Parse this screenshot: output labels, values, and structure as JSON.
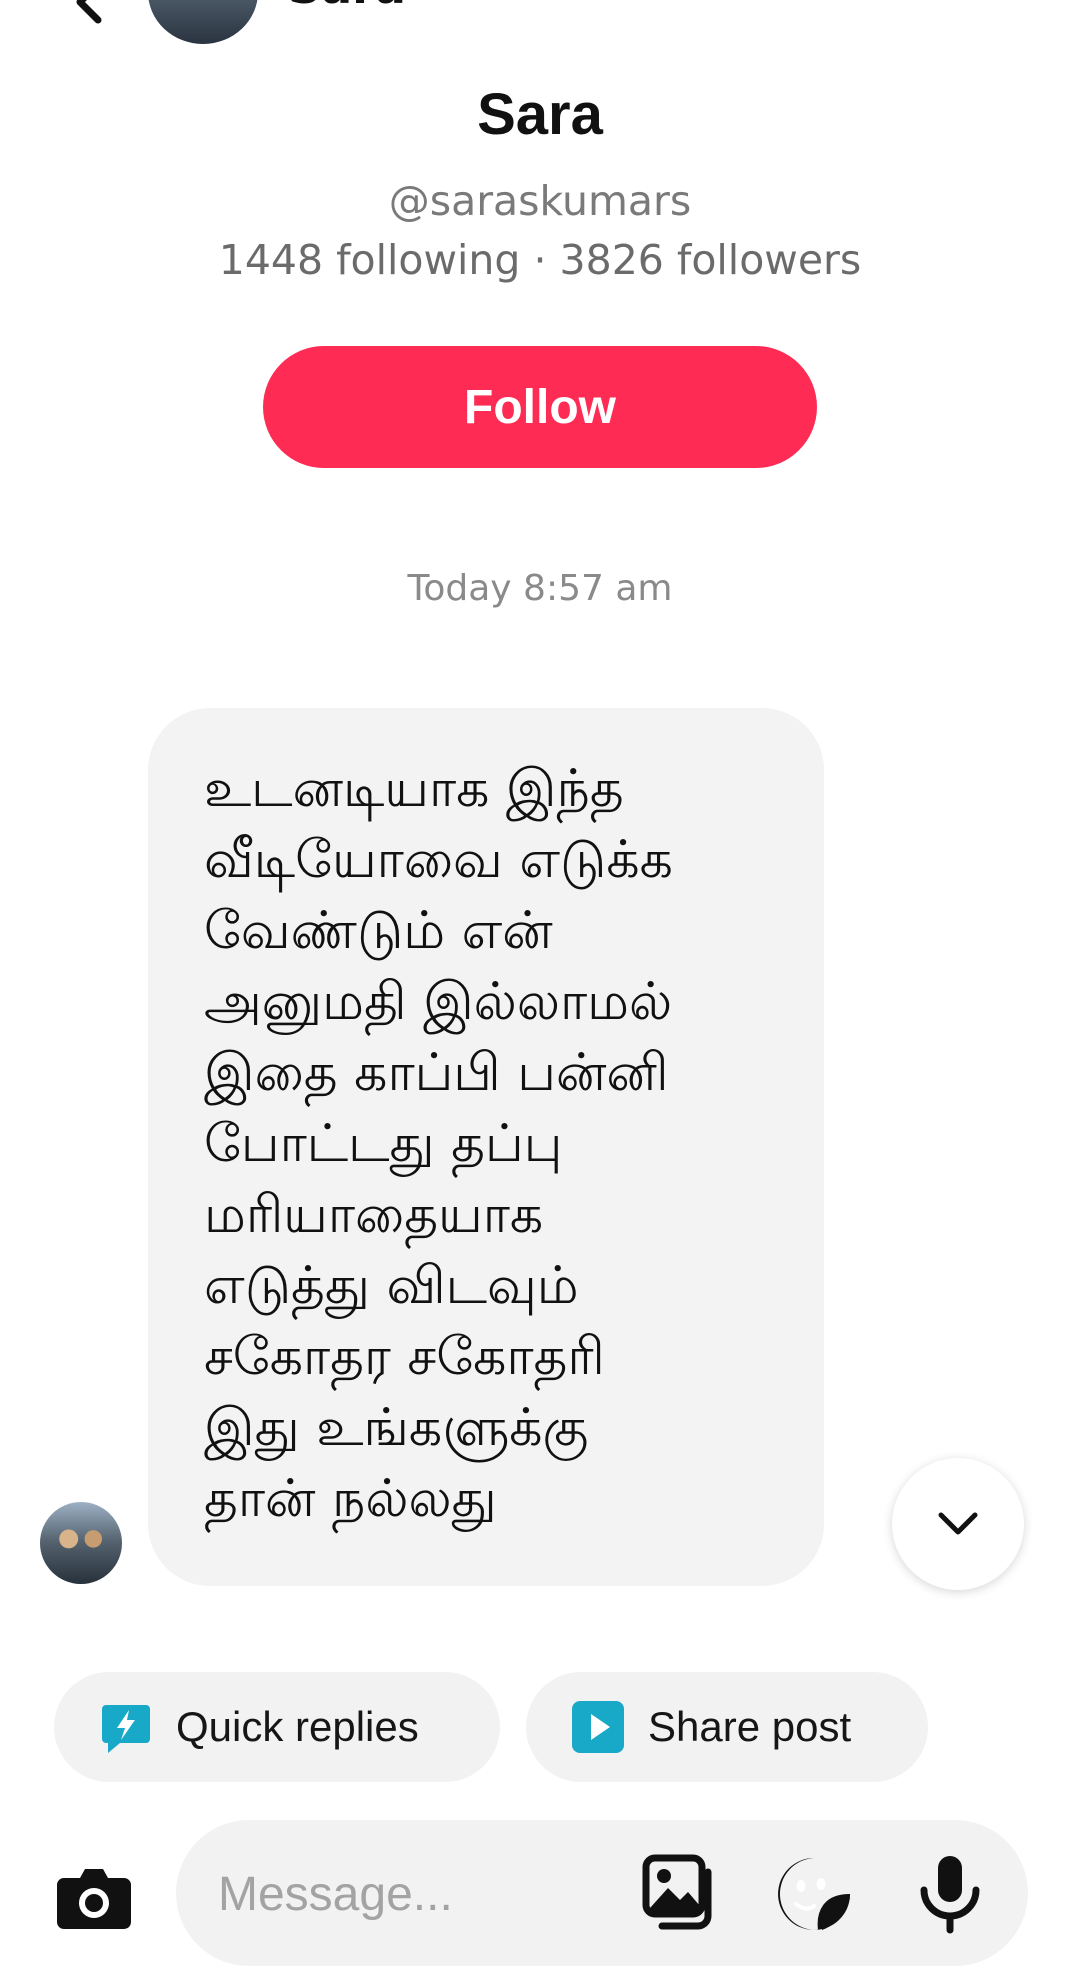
{
  "header": {
    "name": "Sara"
  },
  "profile": {
    "name": "Sara",
    "handle": "@saraskumars",
    "stats": "1448 following · 3826 followers",
    "follow_label": "Follow"
  },
  "conversation": {
    "timestamp": "Today 8:57 am",
    "message": "உடனடியாக இந்த\nவீடியோவை எடுக்க\nவேண்டும் என்\nஅனுமதி இல்லாமல்\nஇதை காப்பி பன்னி\nபோட்டது தப்பு\nமரியாதையாக\nஎடுத்து விடவும்\nசகோதர சகோதரி\nஇது உங்களுக்கு\nதான் நல்லது"
  },
  "chips": {
    "quick_replies": "Quick replies",
    "share_post": "Share post"
  },
  "composer": {
    "placeholder": "Message..."
  },
  "colors": {
    "accent": "#fe2c55",
    "chip_icon": "#18a8c8",
    "bubble": "#f3f3f3"
  },
  "icons": [
    "back-icon",
    "camera-icon",
    "gallery-icon",
    "sticker-icon",
    "mic-icon",
    "chevron-down-icon",
    "quick-reply-icon",
    "share-post-icon"
  ]
}
